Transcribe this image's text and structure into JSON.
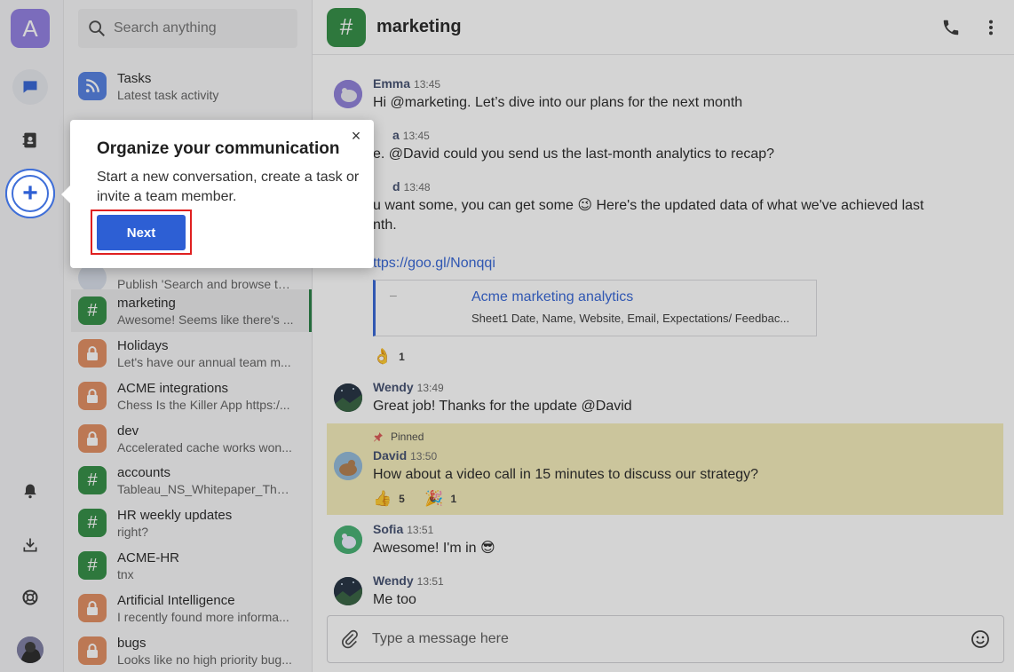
{
  "rail": {
    "workspace_letter": "A"
  },
  "search": {
    "placeholder": "Search anything"
  },
  "channels": [
    {
      "name": "Tasks",
      "sub": "Latest task activity",
      "icon": "rss-icon",
      "color": "#4e7be0"
    },
    {
      "name": "",
      "sub": "Publish 'Search and browse ta...",
      "icon": "avatar",
      "color": "#cfd6e0"
    },
    {
      "name": "marketing",
      "sub": "Awesome! Seems like there's ...",
      "icon": "hash-icon",
      "color": "#2b8a3e"
    },
    {
      "name": "Holidays",
      "sub": "Let's have our annual team m...",
      "icon": "lock-icon",
      "color": "#e1895b"
    },
    {
      "name": "ACME integrations",
      "sub": "Chess Is the Killer App https:/...",
      "icon": "lock-icon",
      "color": "#e1895b"
    },
    {
      "name": "dev",
      "sub": "Accelerated cache works won...",
      "icon": "lock-icon",
      "color": "#e1895b"
    },
    {
      "name": "accounts",
      "sub": "Tableau_NS_Whitepaper_The_...",
      "icon": "hash-icon",
      "color": "#2b8a3e"
    },
    {
      "name": "HR weekly updates",
      "sub": "right?",
      "icon": "hash-icon",
      "color": "#2b8a3e"
    },
    {
      "name": "ACME-HR",
      "sub": "tnx",
      "icon": "hash-icon",
      "color": "#2b8a3e"
    },
    {
      "name": "Artificial Intelligence",
      "sub": "I recently found more informa...",
      "icon": "lock-icon",
      "color": "#e1895b"
    },
    {
      "name": "bugs",
      "sub": "Looks like no high priority bug...",
      "icon": "lock-icon",
      "color": "#e1895b"
    }
  ],
  "header": {
    "title": "marketing"
  },
  "messages": [
    {
      "name": "Emma",
      "time": "13:45",
      "text": "Hi @marketing. Let’s dive into our plans for the next month"
    },
    {
      "name": "a",
      "time": "13:45",
      "text": "e. @David could you send us the last-month analytics to recap?"
    },
    {
      "name": "d",
      "time": "13:48",
      "text": "u want some, you can get some 😉 Here's the updated data of what we've achieved last",
      "text2": "nth."
    },
    {
      "name": "Wendy",
      "time": "13:49",
      "text": "Great job! Thanks for the update @David"
    },
    {
      "name": "David",
      "time": "13:50",
      "text": "How about a video call in 15 minutes to discuss our strategy?"
    },
    {
      "name": "Sofia",
      "time": "13:51",
      "text": "Awesome! I'm in 😎"
    },
    {
      "name": "Wendy",
      "time": "13:51",
      "text": "Me too"
    }
  ],
  "link": {
    "url": "ttps://goo.gl/Nonqqi",
    "card_title": "Acme marketing analytics",
    "card_desc": "Sheet1 Date, Name, Website, Email, Expectations/ Feedbac..."
  },
  "reactions": {
    "analytics": [
      {
        "emoji": "👌",
        "count": "1"
      }
    ],
    "david": [
      {
        "emoji": "👍",
        "count": "5"
      },
      {
        "emoji": "🎉",
        "count": "1"
      }
    ]
  },
  "pinned_label": "Pinned",
  "composer": {
    "placeholder": "Type a message here"
  },
  "tooltip": {
    "title": "Organize your communication",
    "body": "Start a new conversation, create a task or invite a team member.",
    "next_label": "Next",
    "close_glyph": "×"
  }
}
